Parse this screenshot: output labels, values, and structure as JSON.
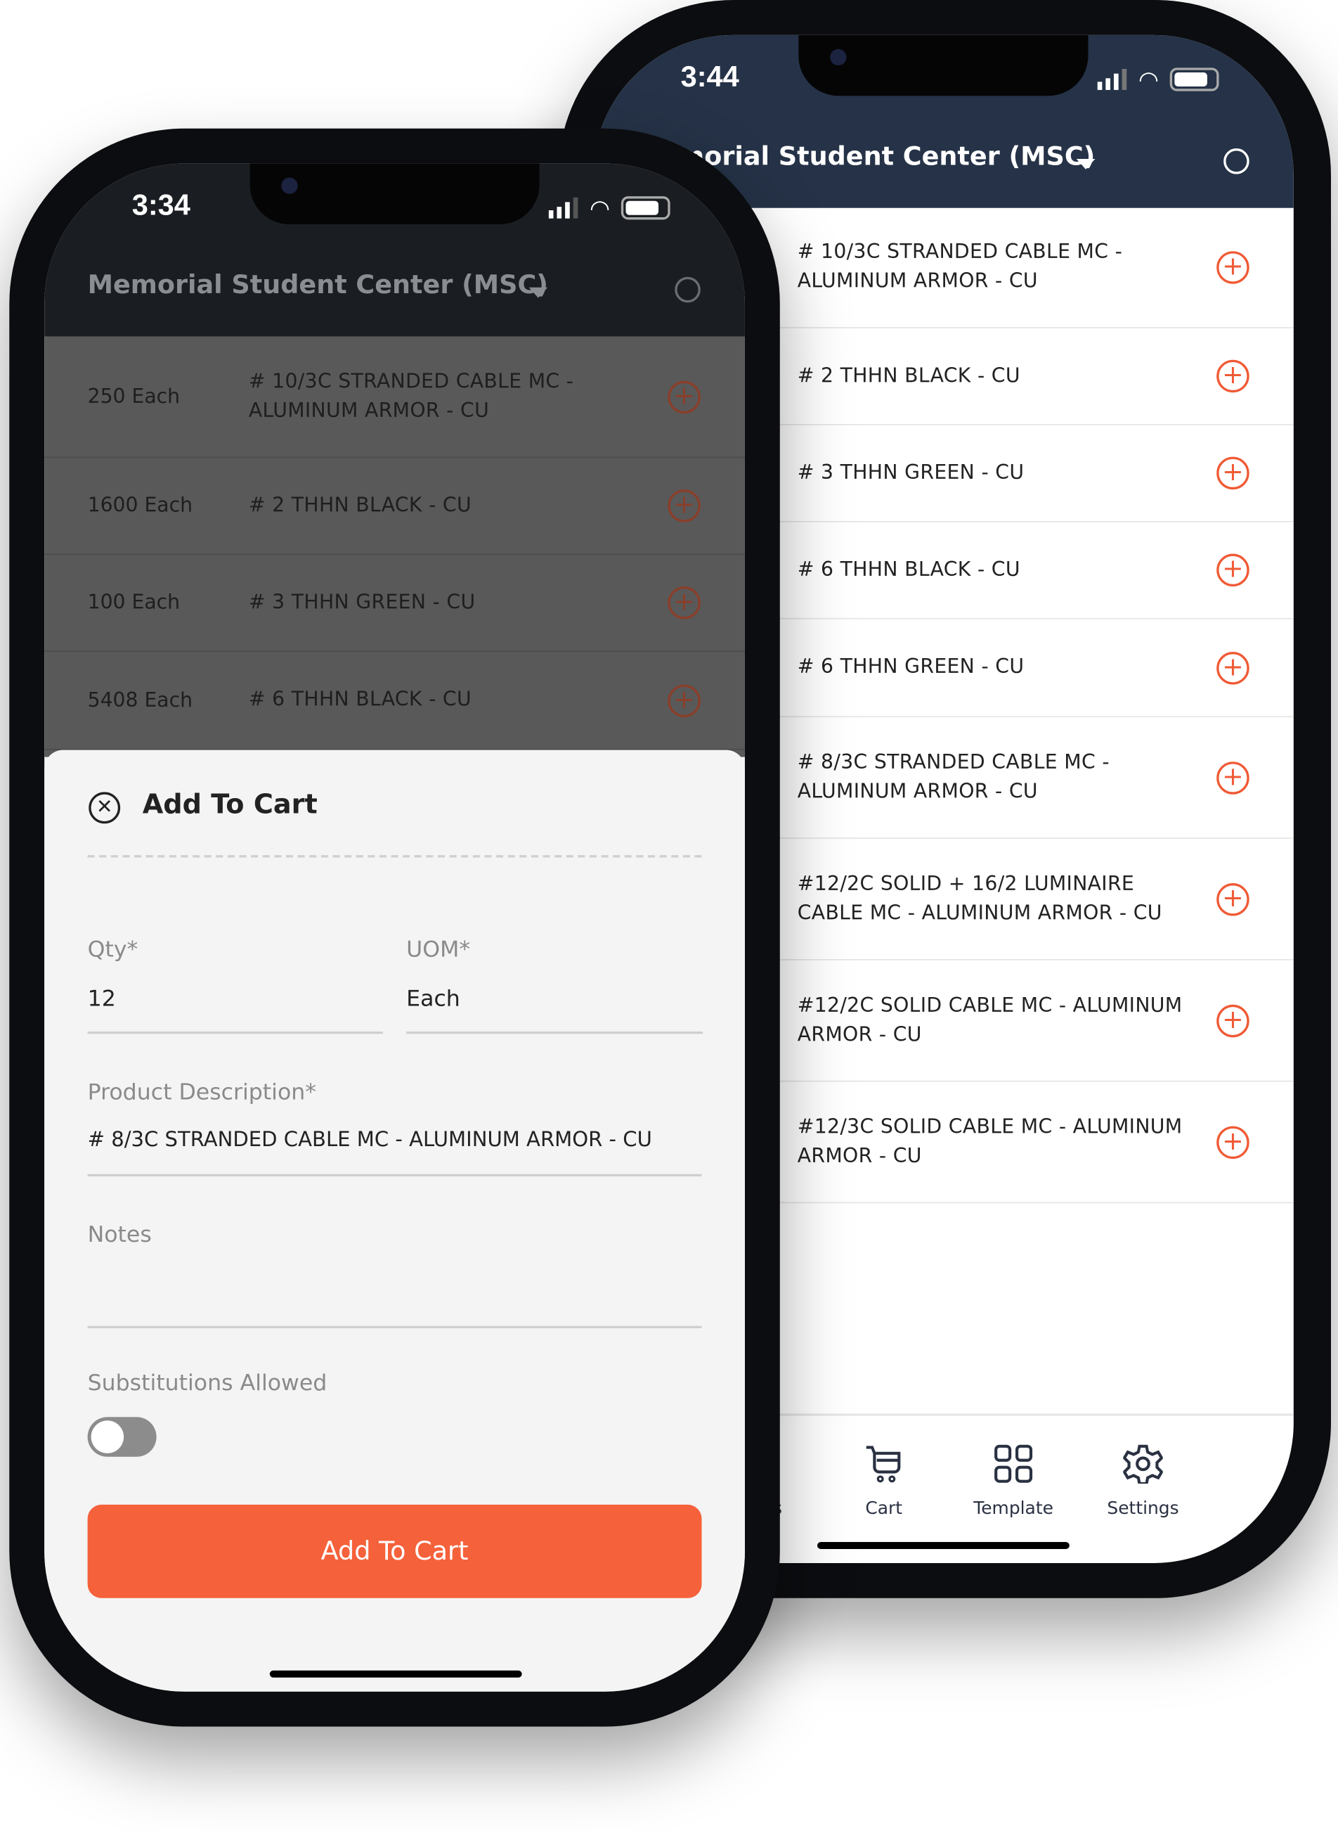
{
  "back": {
    "time": "3:44",
    "title": "Memorial Student Center (MSC)",
    "items": [
      "# 10/3C STRANDED CABLE MC - ALUMINUM ARMOR - CU",
      "# 2 THHN BLACK - CU",
      "# 3 THHN GREEN - CU",
      "# 6 THHN BLACK - CU",
      "# 6 THHN GREEN - CU",
      "# 8/3C STRANDED CABLE MC - ALUMINUM ARMOR - CU",
      "#12/2C SOLID + 16/2 LUMINAIRE CABLE MC - ALUMINUM ARMOR - CU",
      "#12/2C SOLID CABLE MC - ALUMINUM ARMOR - CU",
      "#12/3C SOLID CABLE MC - ALUMINUM ARMOR - CU"
    ],
    "nav": [
      {
        "label": "Status",
        "icon": "calendar-check-icon"
      },
      {
        "label": "Cart",
        "icon": "cart-icon"
      },
      {
        "label": "Template",
        "icon": "grid-icon"
      },
      {
        "label": "Settings",
        "icon": "gear-icon"
      }
    ]
  },
  "front": {
    "time": "3:34",
    "title": "Memorial Student Center (MSC)",
    "items": [
      {
        "qty": "250 Each",
        "desc": "# 10/3C STRANDED CABLE MC - ALUMINUM ARMOR - CU"
      },
      {
        "qty": "1600 Each",
        "desc": "# 2 THHN BLACK - CU"
      },
      {
        "qty": "100 Each",
        "desc": "# 3 THHN GREEN - CU"
      },
      {
        "qty": "5408 Each",
        "desc": "# 6 THHN BLACK - CU"
      }
    ],
    "sheet": {
      "title": "Add To Cart",
      "qty_label": "Qty*",
      "qty_value": "12",
      "uom_label": "UOM*",
      "uom_value": "Each",
      "desc_label": "Product Description*",
      "desc_value": "# 8/3C STRANDED CABLE MC - ALUMINUM ARMOR - CU",
      "notes_label": "Notes",
      "notes_value": "",
      "subs_label": "Substitutions Allowed",
      "subs_on": false,
      "button": "Add To Cart"
    }
  },
  "colors": {
    "accent": "#f5613a",
    "header_back": "#253247",
    "header_front_dimmed": "#1a1d22"
  }
}
